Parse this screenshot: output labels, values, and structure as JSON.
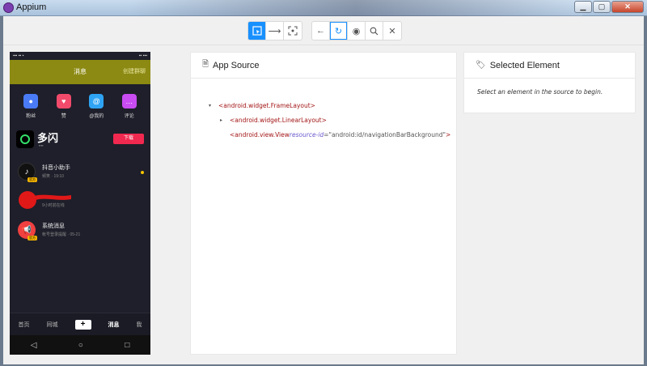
{
  "window": {
    "title": "Appium"
  },
  "toolbar": {
    "mode_buttons": [
      "select-elements-icon",
      "swipe-icon",
      "tap-coordinates-icon"
    ],
    "action_buttons": [
      "back-icon",
      "refresh-icon",
      "show-icon",
      "search-icon",
      "close-icon"
    ]
  },
  "device": {
    "header_title": "消息",
    "header_action": "创建群聊",
    "shortcuts": [
      {
        "label": "粉丝",
        "color": "#4a7bf7"
      },
      {
        "label": "赞",
        "color": "#f24a6b"
      },
      {
        "label": "@我的",
        "color": "#2fa3f3"
      },
      {
        "label": "评论",
        "color": "#c84cf2"
      }
    ],
    "banner": {
      "brand": "多闪",
      "download": "下载"
    },
    "messages": [
      {
        "name": "抖音小助手",
        "meta": "频笑 · 19:10",
        "tag": "官方"
      },
      {
        "name": "",
        "meta": "9小时前在线",
        "tag": ""
      },
      {
        "name": "系统消息",
        "meta": "帐号登录提醒 · 05-21",
        "tag": "官方"
      }
    ],
    "tabs": [
      "首页",
      "同城",
      "+",
      "消息",
      "我"
    ],
    "nav": [
      "◁",
      "○",
      "□"
    ]
  },
  "source_panel": {
    "title": "App Source",
    "nodes": [
      {
        "caret": "▾",
        "text": "<android.widget.FrameLayout>"
      },
      {
        "caret": "▸",
        "text": "<android.widget.LinearLayout>"
      },
      {
        "caret": "",
        "text": "<android.view.View ",
        "attr_name": "resource-id",
        "attr_eq": "=",
        "attr_val": "\"android:id/navigationBarBackground\"",
        "close": ">"
      }
    ]
  },
  "selected_panel": {
    "title": "Selected Element",
    "hint": "Select an element in the source to begin."
  }
}
